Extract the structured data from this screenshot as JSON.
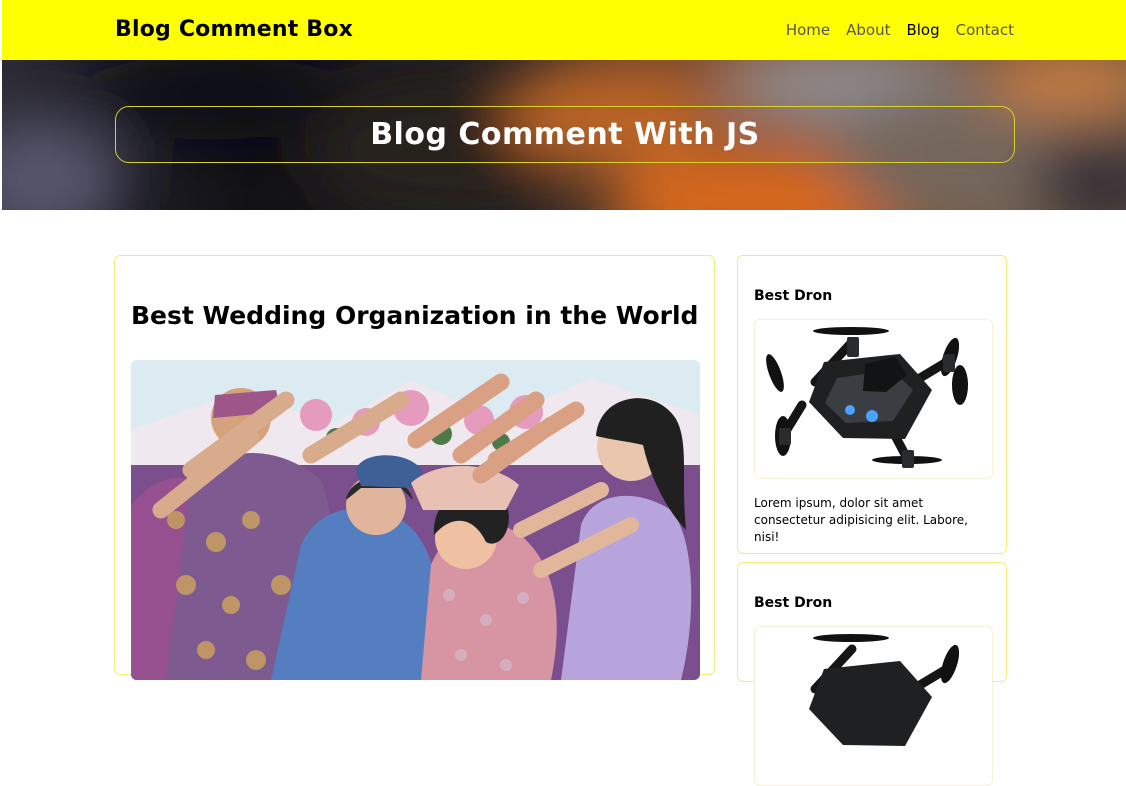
{
  "header": {
    "brand": "Blog Comment Box",
    "nav": [
      {
        "label": "Home"
      },
      {
        "label": "About"
      },
      {
        "label": "Blog"
      },
      {
        "label": "Contact"
      }
    ],
    "active_nav": "Blog"
  },
  "hero": {
    "title": "Blog Comment With JS"
  },
  "post": {
    "title": "Best Wedding Organization in the World",
    "image": "wedding-photo"
  },
  "sidebar": {
    "cards": [
      {
        "title": "Best Dron",
        "image": "drone-photo",
        "text": "Lorem ipsum, dolor sit amet consectetur adipisicing elit. Labore, nisi!"
      },
      {
        "title": "Best Dron",
        "image": "drone-photo"
      }
    ]
  },
  "colors": {
    "navbar": "#ffff00",
    "card_border": "#f0ec7e",
    "hero_border": "#d7d12a"
  }
}
